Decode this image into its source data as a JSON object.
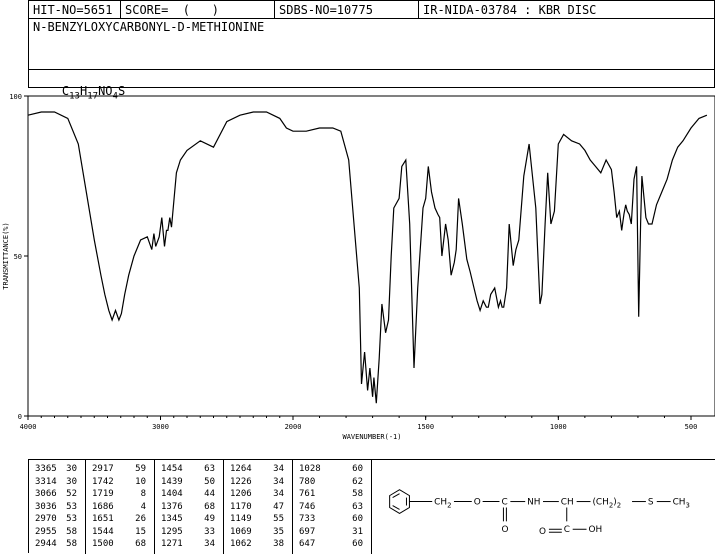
{
  "header": {
    "hit_no": "HIT-NO=5651",
    "score": "SCORE=  (   )",
    "sdbs_no": "SDBS-NO=10775",
    "ir": "IR-NIDA-03784 : KBR DISC"
  },
  "compound_name": "N-BENZYLOXYCARBONYL-D-METHIONINE",
  "formula": {
    "c": "C",
    "c_n": "13",
    "h": "H",
    "h_n": "17",
    "rest": "NO",
    "o_n": "4",
    "s": "S"
  },
  "chart_data": {
    "type": "line",
    "xlabel": "WAVENUMBER(-1)",
    "ylabel": "TRANSMITTANCE(%)",
    "x_ticks": [
      "4000",
      "3000",
      "2000",
      "1500",
      "1000",
      "500"
    ],
    "y_ticks": [
      "100",
      "50",
      "0"
    ],
    "ylim": [
      0,
      100
    ],
    "x": [
      4000,
      3900,
      3800,
      3700,
      3620,
      3560,
      3500,
      3450,
      3420,
      3390,
      3365,
      3340,
      3314,
      3295,
      3270,
      3240,
      3200,
      3150,
      3100,
      3066,
      3050,
      3036,
      3010,
      2990,
      2970,
      2955,
      2944,
      2930,
      2917,
      2880,
      2850,
      2800,
      2700,
      2600,
      2500,
      2400,
      2300,
      2200,
      2100,
      2050,
      2000,
      1950,
      1900,
      1850,
      1820,
      1790,
      1770,
      1750,
      1742,
      1730,
      1719,
      1710,
      1700,
      1695,
      1686,
      1675,
      1665,
      1651,
      1640,
      1630,
      1620,
      1600,
      1590,
      1575,
      1560,
      1544,
      1530,
      1510,
      1500,
      1490,
      1478,
      1465,
      1454,
      1447,
      1439,
      1425,
      1415,
      1404,
      1392,
      1385,
      1376,
      1362,
      1345,
      1332,
      1318,
      1306,
      1295,
      1283,
      1271,
      1264,
      1255,
      1240,
      1226,
      1218,
      1212,
      1206,
      1195,
      1185,
      1170,
      1160,
      1149,
      1130,
      1110,
      1085,
      1069,
      1062,
      1050,
      1040,
      1028,
      1015,
      1000,
      980,
      950,
      920,
      900,
      880,
      860,
      840,
      820,
      800,
      790,
      780,
      770,
      761,
      753,
      746,
      740,
      733,
      725,
      715,
      705,
      697,
      690,
      685,
      670,
      660,
      647,
      630,
      610,
      590,
      570,
      550,
      530,
      500,
      470,
      440,
      420,
      400
    ],
    "y": [
      94,
      95,
      95,
      93,
      85,
      70,
      55,
      44,
      38,
      33,
      30,
      33,
      30,
      32,
      38,
      44,
      50,
      55,
      56,
      52,
      57,
      53,
      56,
      62,
      53,
      58,
      58,
      62,
      59,
      76,
      80,
      83,
      86,
      84,
      92,
      94,
      95,
      95,
      93,
      90,
      89,
      89,
      90,
      90,
      89,
      80,
      60,
      40,
      10,
      20,
      8,
      15,
      6,
      12,
      4,
      18,
      35,
      26,
      30,
      50,
      65,
      68,
      78,
      80,
      60,
      15,
      40,
      65,
      68,
      78,
      70,
      65,
      63,
      62,
      50,
      60,
      55,
      44,
      48,
      52,
      68,
      60,
      49,
      45,
      40,
      36,
      33,
      36,
      34,
      34,
      38,
      40,
      34,
      36,
      34,
      34,
      40,
      60,
      47,
      52,
      55,
      75,
      85,
      65,
      35,
      38,
      60,
      76,
      60,
      64,
      85,
      88,
      86,
      85,
      83,
      80,
      78,
      76,
      80,
      77,
      70,
      62,
      64,
      58,
      63,
      66,
      64,
      63,
      60,
      74,
      78,
      31,
      60,
      75,
      62,
      60,
      60,
      66,
      70,
      74,
      80,
      84,
      86,
      90,
      93,
      94
    ]
  },
  "peaks": [
    {
      "wn": "3365",
      "t": "30"
    },
    {
      "wn": "3314",
      "t": "30"
    },
    {
      "wn": "3066",
      "t": "52"
    },
    {
      "wn": "3036",
      "t": "53"
    },
    {
      "wn": "2970",
      "t": "53"
    },
    {
      "wn": "2955",
      "t": "58"
    },
    {
      "wn": "2944",
      "t": "58"
    },
    {
      "wn": "2917",
      "t": "59"
    },
    {
      "wn": "1742",
      "t": "10"
    },
    {
      "wn": "1719",
      "t": "8"
    },
    {
      "wn": "1686",
      "t": "4"
    },
    {
      "wn": "1651",
      "t": "26"
    },
    {
      "wn": "1544",
      "t": "15"
    },
    {
      "wn": "1500",
      "t": "68"
    },
    {
      "wn": "1454",
      "t": "63"
    },
    {
      "wn": "1439",
      "t": "50"
    },
    {
      "wn": "1404",
      "t": "44"
    },
    {
      "wn": "1376",
      "t": "68"
    },
    {
      "wn": "1345",
      "t": "49"
    },
    {
      "wn": "1295",
      "t": "33"
    },
    {
      "wn": "1271",
      "t": "34"
    },
    {
      "wn": "1264",
      "t": "34"
    },
    {
      "wn": "1226",
      "t": "34"
    },
    {
      "wn": "1206",
      "t": "34"
    },
    {
      "wn": "1170",
      "t": "47"
    },
    {
      "wn": "1149",
      "t": "55"
    },
    {
      "wn": "1069",
      "t": "35"
    },
    {
      "wn": "1062",
      "t": "38"
    },
    {
      "wn": "1028",
      "t": "60"
    },
    {
      "wn": "780",
      "t": "62"
    },
    {
      "wn": "761",
      "t": "58"
    },
    {
      "wn": "746",
      "t": "63"
    },
    {
      "wn": "733",
      "t": "60"
    },
    {
      "wn": "697",
      "t": "31"
    },
    {
      "wn": "647",
      "t": "60"
    }
  ],
  "structure": {
    "ch2_1": "CH",
    "ch2_1_sub": "2",
    "o_link": "O",
    "c_carbonyl": "C",
    "nh": "NH",
    "ch": "CH",
    "chain": "(CH",
    "chain_sub": "2",
    "chain_close": ")",
    "chain_n": "2",
    "s": "S",
    "ch3": "CH",
    "ch3_sub": "3",
    "o_carbonyl": "O",
    "cooh_c": "C",
    "oh": "OH",
    "o_acid": "O"
  }
}
